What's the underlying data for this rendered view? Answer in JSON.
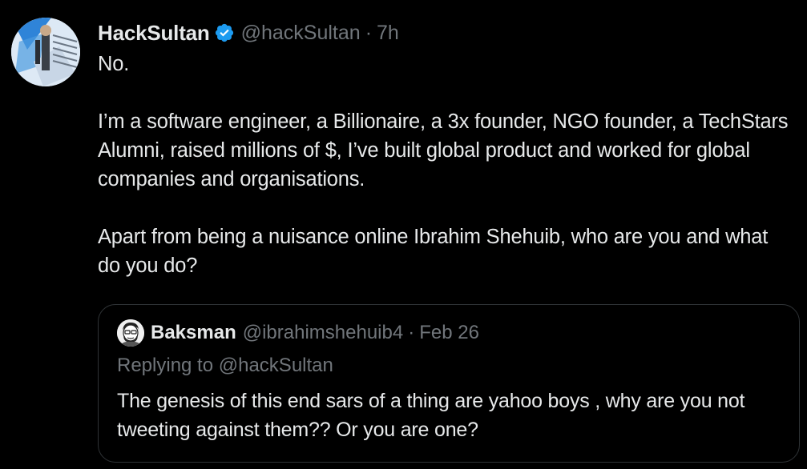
{
  "tweet": {
    "author": {
      "display_name": "HackSultan",
      "handle": "@hackSultan",
      "verified": true,
      "verified_icon": "verified-badge-icon",
      "verified_color": "#1d9bf0"
    },
    "separator": "·",
    "time": "7h",
    "paragraphs": [
      "No.",
      "I’m a software engineer, a Billionaire, a 3x founder, NGO founder, a TechStars Alumni, raised millions of $, I’ve built global product and worked for global companies and organisations.",
      "Apart from being a nuisance online Ibrahim Shehuib, who are you and what do you do?"
    ]
  },
  "quote": {
    "author": {
      "display_name": "Baksman",
      "handle": "@ibrahimshehuib4"
    },
    "separator": "·",
    "date": "Feb 26",
    "replying_prefix": "Replying to",
    "replying_handle": "@hackSultan",
    "text": "The genesis of this end sars of a thing are yahoo boys , why are you not tweeting against them?? Or you are one?"
  },
  "colors": {
    "background": "#000000",
    "primary_text": "#e7e9ea",
    "secondary_text": "#71767b",
    "border": "#2f3336",
    "accent": "#1d9bf0"
  }
}
